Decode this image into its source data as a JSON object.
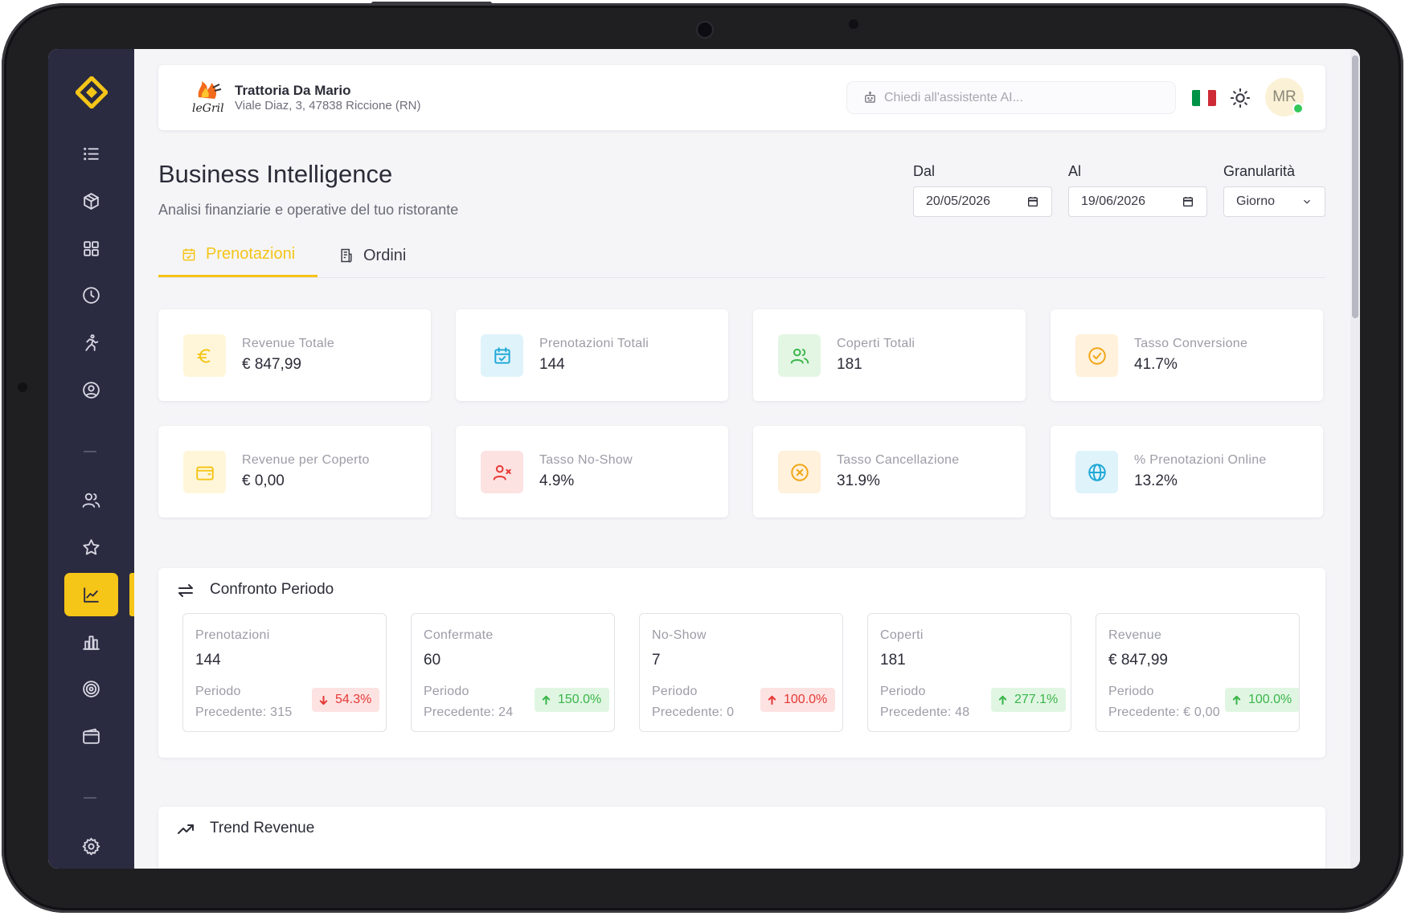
{
  "restaurant": {
    "name": "Trattoria Da Mario",
    "address": "Viale Diaz, 3, 47838 Riccione (RN)"
  },
  "search": {
    "placeholder": "Chiedi all'assistente AI..."
  },
  "user": {
    "initials": "MR"
  },
  "language_flag": [
    "#009246",
    "#ffffff",
    "#ce2b37"
  ],
  "page": {
    "title": "Business Intelligence",
    "subtitle": "Analisi finanziarie e operative del tuo ristorante"
  },
  "filters": {
    "from_label": "Dal",
    "from_value": "20/05/2026",
    "to_label": "Al",
    "to_value": "19/06/2026",
    "granularity_label": "Granularità",
    "granularity_value": "Giorno"
  },
  "tabs": [
    {
      "label": "Prenotazioni",
      "icon": "calendar-check-icon",
      "active": true
    },
    {
      "label": "Ordini",
      "icon": "receipt-icon",
      "active": false
    }
  ],
  "kpis": [
    {
      "label": "Revenue Totale",
      "value": "€ 847,99",
      "icon": "euro-icon",
      "color": "#f5c518",
      "bg": "#fff6da"
    },
    {
      "label": "Prenotazioni Totali",
      "value": "144",
      "icon": "calendar-check-icon",
      "color": "#1fa8d6",
      "bg": "#dff3fb"
    },
    {
      "label": "Coperti Totali",
      "value": "181",
      "icon": "users-icon",
      "color": "#3ab54a",
      "bg": "#e3f6e4"
    },
    {
      "label": "Tasso Conversione",
      "value": "41.7%",
      "icon": "check-circle-icon",
      "color": "#f2a516",
      "bg": "#fff1db"
    },
    {
      "label": "Revenue per Coperto",
      "value": "€ 0,00",
      "icon": "wallet-icon",
      "color": "#f5c518",
      "bg": "#fff6da"
    },
    {
      "label": "Tasso No-Show",
      "value": "4.9%",
      "icon": "user-x-icon",
      "color": "#e53935",
      "bg": "#fde2e2"
    },
    {
      "label": "Tasso Cancellazione",
      "value": "31.9%",
      "icon": "x-circle-icon",
      "color": "#f2a516",
      "bg": "#fff1db"
    },
    {
      "label": "% Prenotazioni Online",
      "value": "13.2%",
      "icon": "globe-icon",
      "color": "#1fa8d6",
      "bg": "#dff3fb"
    }
  ],
  "comparison": {
    "title": "Confronto Periodo",
    "items": [
      {
        "label": "Prenotazioni",
        "value": "144",
        "prev_line1": "Periodo",
        "prev_line2": "Precedente: 315",
        "delta": "54.3%",
        "direction": "down"
      },
      {
        "label": "Confermate",
        "value": "60",
        "prev_line1": "Periodo",
        "prev_line2": "Precedente: 24",
        "delta": "150.0%",
        "direction": "up"
      },
      {
        "label": "No-Show",
        "value": "7",
        "prev_line1": "Periodo",
        "prev_line2": "Precedente: 0",
        "delta": "100.0%",
        "direction": "up-red"
      },
      {
        "label": "Coperti",
        "value": "181",
        "prev_line1": "Periodo",
        "prev_line2": "Precedente: 48",
        "delta": "277.1%",
        "direction": "up"
      },
      {
        "label": "Revenue",
        "value": "€ 847,99",
        "prev_line1": "Periodo",
        "prev_line2": "Precedente: € 0,00",
        "delta": "100.0%",
        "direction": "up"
      }
    ]
  },
  "trend": {
    "title": "Trend Revenue"
  },
  "sidebar": {
    "items": [
      {
        "name": "menu-list",
        "icon": "list-icon"
      },
      {
        "name": "products",
        "icon": "box-icon"
      },
      {
        "name": "tables",
        "icon": "grid-icon"
      },
      {
        "name": "history",
        "icon": "clock-icon"
      },
      {
        "name": "activity",
        "icon": "running-icon"
      },
      {
        "name": "profile",
        "icon": "user-circle-icon"
      },
      {
        "name": "customers",
        "icon": "users-icon"
      },
      {
        "name": "reviews",
        "icon": "star-icon"
      },
      {
        "name": "analytics",
        "icon": "line-chart-icon",
        "active": true
      },
      {
        "name": "reports",
        "icon": "bar-chart-icon"
      },
      {
        "name": "goals",
        "icon": "target-icon"
      },
      {
        "name": "wallet",
        "icon": "wallet-icon"
      },
      {
        "name": "settings",
        "icon": "gear-icon"
      }
    ]
  }
}
